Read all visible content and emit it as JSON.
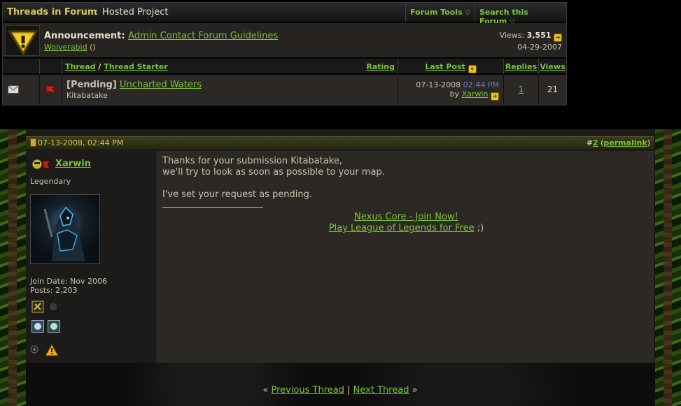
{
  "forum_bar": {
    "title": "Threads in Forum",
    "separator": ":",
    "forum_name": "Hosted Project",
    "tools": [
      {
        "label": "Forum Tools"
      },
      {
        "label": "Search this Forum"
      }
    ]
  },
  "announcement": {
    "prefix": "Announcement",
    "title": "Admin Contact Forum Guidelines",
    "author": "Wolverabid",
    "author_suffix": "()",
    "views_label": "Views:",
    "views": "3,551",
    "date": "04-29-2007"
  },
  "columns": {
    "thread": "Thread",
    "slash": "/",
    "thread_starter": "Thread Starter",
    "rating": "Rating",
    "last_post": "Last Post",
    "replies": "Replies",
    "views": "Views"
  },
  "threads": [
    {
      "prefix": "[Pending]",
      "title": "Uncharted Waters",
      "starter": "Kitabatake",
      "last_post_date": "07-13-2008",
      "last_post_time": "02:44 PM",
      "by": "by",
      "last_poster": "Xarwin",
      "replies": "1",
      "views": "21"
    }
  ],
  "post": {
    "datetime": "07-13-2008, 02:44 PM",
    "hash": "#",
    "number": "2",
    "paren_open": "(",
    "permalink": "permalink",
    "paren_close": ")",
    "username": "Xarwin",
    "rank": "Legendary",
    "join_date": "Join Date: Nov 2006",
    "posts": "Posts: 2,203",
    "lines": [
      "Thanks for your submission Kitabatake,",
      "we'll try to look as soon as possible to your map.",
      "I've set your request as pending."
    ],
    "signature_link1": "Nexus Core - Join Now!",
    "signature_link2": "Play League of Legends for Free",
    "signature_suffix": " ;)"
  },
  "thread_nav": {
    "prev_marker": "«",
    "prev": "Previous Thread",
    "divider": "|",
    "next": "Next Thread",
    "next_marker": "»"
  },
  "colors": {
    "link": "#7ec23a",
    "title_gold": "#d8c85a",
    "post_bg": "#2c2925",
    "time_blue": "#6b78c8"
  }
}
